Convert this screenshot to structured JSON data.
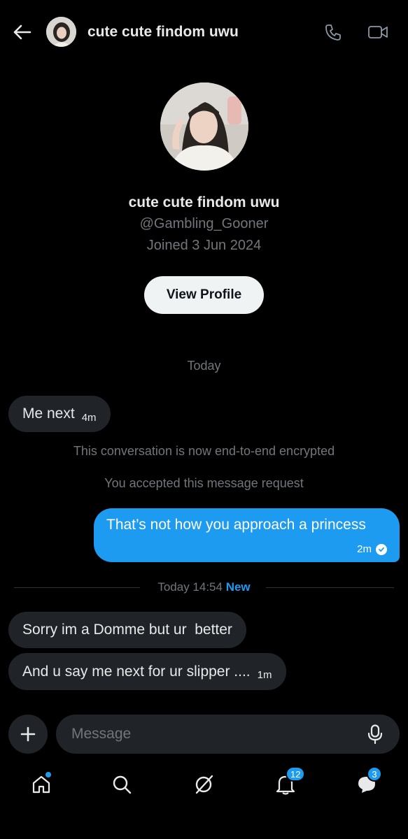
{
  "header": {
    "title": "cute cute findom uwu"
  },
  "profile": {
    "name": "cute cute findom uwu",
    "handle": "@Gambling_Gooner",
    "joined": "Joined 3 Jun 2024",
    "view_profile_label": "View Profile"
  },
  "conversation": {
    "day_label": "Today",
    "messages_in_1": {
      "text": "Me next",
      "time": "4m"
    },
    "system_1": "This conversation is now end-to-end encrypted",
    "system_2": "You accepted this message request",
    "message_out": {
      "text": "That’s not how you approach a princess",
      "time": "2m"
    },
    "divider": {
      "stamp": "Today 14:54",
      "new_label": "New"
    },
    "messages_in_2": {
      "text": "Sorry im a Domme but ur  better"
    },
    "messages_in_3": {
      "text": "And u say me next for ur slipper ....",
      "time": "1m"
    }
  },
  "composer": {
    "placeholder": "Message"
  },
  "nav": {
    "notifications_badge": "12",
    "messages_badge": "3"
  },
  "colors": {
    "accent": "#1d9bf0",
    "bubble_in": "#202327",
    "muted_text": "#71767b"
  }
}
